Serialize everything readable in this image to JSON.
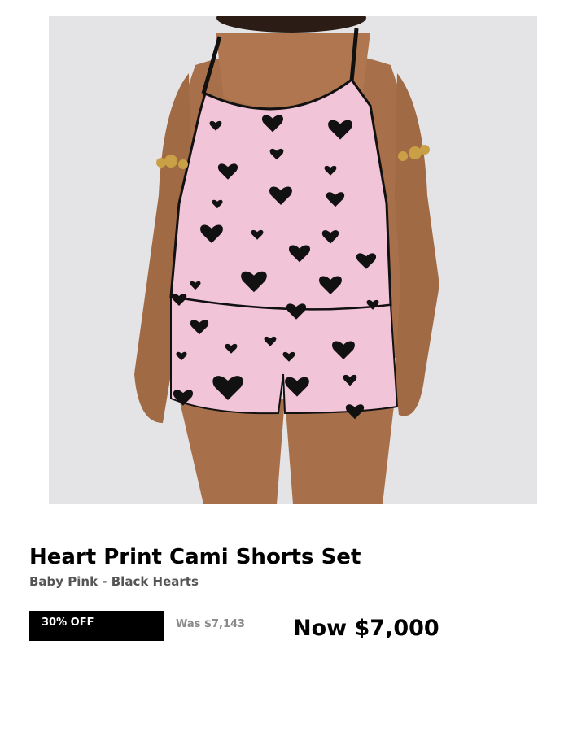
{
  "product": {
    "image_alt": "model wearing baby pink cami and shorts pajama set with black heart print",
    "title": "Heart Print Cami Shorts Set",
    "variant": "Baby Pink - Black Hearts",
    "discount_label": "30% OFF",
    "was_price": "Was $7,143",
    "now_price": "Now $7,000"
  },
  "colors": {
    "image_background": "#e4e4e6",
    "garment_pink": "#f2c4d8",
    "heart_print": "#111111",
    "skin": "#a8704a",
    "badge_background": "#000000",
    "badge_text": "#ffffff",
    "was_price_text": "#8a8a8a"
  }
}
